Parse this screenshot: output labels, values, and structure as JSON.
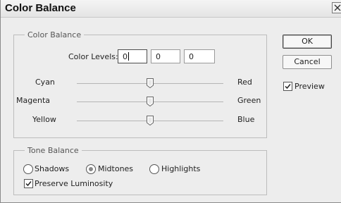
{
  "window": {
    "title": "Color Balance"
  },
  "color_balance": {
    "legend": "Color Balance",
    "levels_label": "Color Levels:",
    "levels": [
      "0",
      "0",
      "0"
    ],
    "sliders": [
      {
        "left": "Cyan",
        "right": "Red",
        "value": 0
      },
      {
        "left": "Magenta",
        "right": "Green",
        "value": 0
      },
      {
        "left": "Yellow",
        "right": "Blue",
        "value": 0
      }
    ]
  },
  "tone_balance": {
    "legend": "Tone Balance",
    "options": [
      "Shadows",
      "Midtones",
      "Highlights"
    ],
    "selected": "Midtones",
    "preserve_label": "Preserve Luminosity",
    "preserve_checked": true
  },
  "buttons": {
    "ok": "OK",
    "cancel": "Cancel"
  },
  "preview": {
    "label": "Preview",
    "checked": true
  }
}
